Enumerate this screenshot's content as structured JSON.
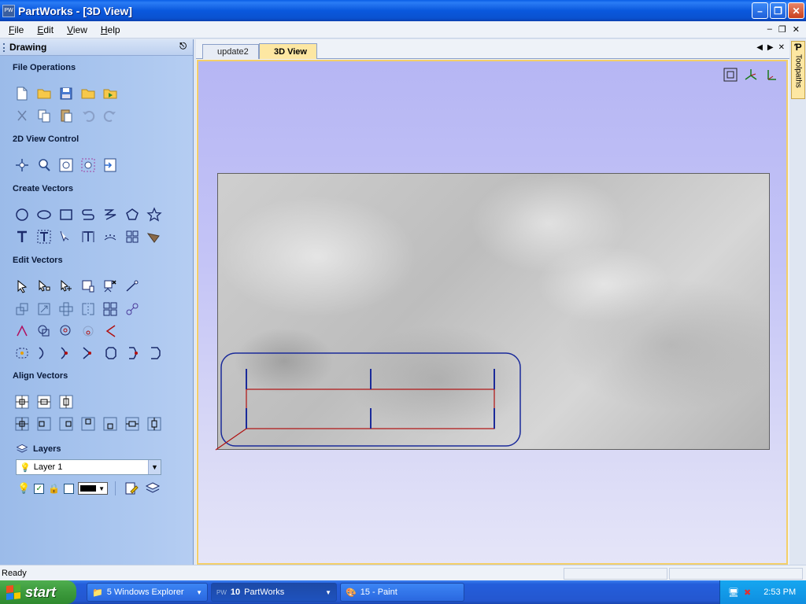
{
  "window": {
    "title": "PartWorks - [3D View]",
    "app_icon_text": "PW"
  },
  "menu": {
    "items": [
      "File",
      "Edit",
      "View",
      "Help"
    ]
  },
  "left_panel": {
    "header": "Drawing",
    "sections": {
      "file_operations": "File Operations",
      "view_control": "2D View Control",
      "create_vectors": "Create Vectors",
      "edit_vectors": "Edit Vectors",
      "align_vectors": "Align Vectors",
      "layers": "Layers"
    },
    "layer_select": {
      "value": "Layer 1"
    }
  },
  "tabs": [
    {
      "label": "update2",
      "active": false
    },
    {
      "label": "3D View",
      "active": true
    }
  ],
  "right_tab": {
    "label": "Toolpaths"
  },
  "status": {
    "text": "Ready"
  },
  "taskbar": {
    "start_label": "start",
    "buttons": [
      {
        "label": "5 Windows Explorer"
      },
      {
        "count": "10",
        "label": "PartWorks"
      },
      {
        "label": "15 - Paint"
      }
    ],
    "clock": "2:53 PM"
  },
  "colors": {
    "accent": "#fde7a2",
    "vector_blue": "#1a2a9a",
    "vector_red": "#b01010"
  }
}
